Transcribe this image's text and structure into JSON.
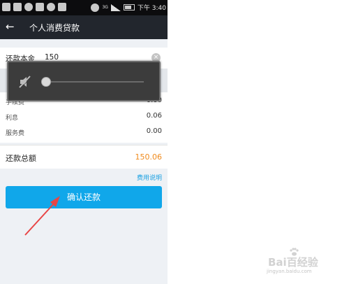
{
  "status_bar": {
    "time": "下午 3:40",
    "network_type": "3G"
  },
  "header": {
    "back_icon": "back-arrow-icon",
    "title": "个人消费贷款"
  },
  "principal": {
    "label": "还款本金",
    "value": "150"
  },
  "fees": {
    "items": [
      {
        "label": "手续费",
        "value": "0.00"
      },
      {
        "label": "利息",
        "value": "0.06"
      },
      {
        "label": "服务费",
        "value": "0.00"
      }
    ]
  },
  "total": {
    "label": "还款总额",
    "value": "150.06",
    "color": "#f08a1c"
  },
  "fee_link": "费用说明",
  "confirm_button": {
    "label": "确认还款",
    "color": "#10a7ea"
  },
  "volume_overlay": {
    "muted": true,
    "level": 0.0
  },
  "watermark": {
    "text": "Bai百经验",
    "sub": "jingyan.baidu.com"
  }
}
